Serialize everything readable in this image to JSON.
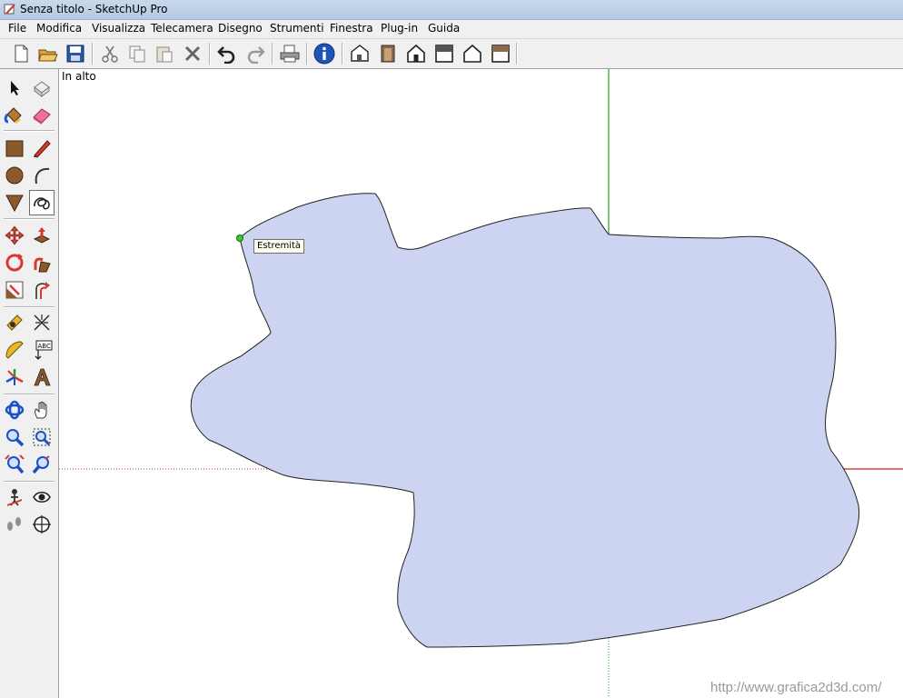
{
  "window": {
    "title": "Senza titolo - SketchUp Pro"
  },
  "menubar": {
    "items": [
      "File",
      "Modifica",
      "Visualizza",
      "Telecamera",
      "Disegno",
      "Strumenti",
      "Finestra",
      "Plug-in",
      "Guida"
    ]
  },
  "toolbar": {
    "icons": [
      "new-file-icon",
      "open-folder-icon",
      "save-icon",
      "cut-icon",
      "copy-icon",
      "paste-icon",
      "erase-x-icon",
      "undo-icon",
      "redo-icon",
      "print-icon",
      "model-info-icon",
      "iso-view-icon",
      "front-view-icon",
      "top-house-view-icon",
      "right-view-icon",
      "back-view-icon",
      "left-view-icon"
    ]
  },
  "palette": {
    "icons": [
      "select-arrow-icon",
      "make-component-icon",
      "paint-bucket-icon",
      "eraser-icon",
      "rectangle-icon",
      "pencil-line-icon",
      "circle-icon",
      "arc-icon",
      "polygon-icon",
      "freehand-icon",
      "move-icon",
      "push-pull-icon",
      "rotate-icon",
      "follow-me-icon",
      "scale-icon",
      "offset-icon",
      "tape-measure-icon",
      "dimension-icon",
      "protractor-icon",
      "text-label-icon",
      "axes-icon",
      "3d-text-icon",
      "orbit-icon",
      "pan-hand-icon",
      "zoom-icon",
      "zoom-window-icon",
      "zoom-extents-icon",
      "previous-view-icon",
      "position-camera-icon",
      "look-around-icon",
      "walk-icon",
      "section-plane-icon"
    ],
    "active": "freehand-icon",
    "text_label_glyph": "ABC"
  },
  "viewport": {
    "view_label": "In alto",
    "tooltip": "Estremità",
    "watermark": "http://www.grafica2d3d.com/",
    "face_fill": "#cdd4f2",
    "green_axis_color": "#1fa51f",
    "red_axis_color": "#cc1e1e",
    "endpoint_color": "#2ecc2e"
  }
}
